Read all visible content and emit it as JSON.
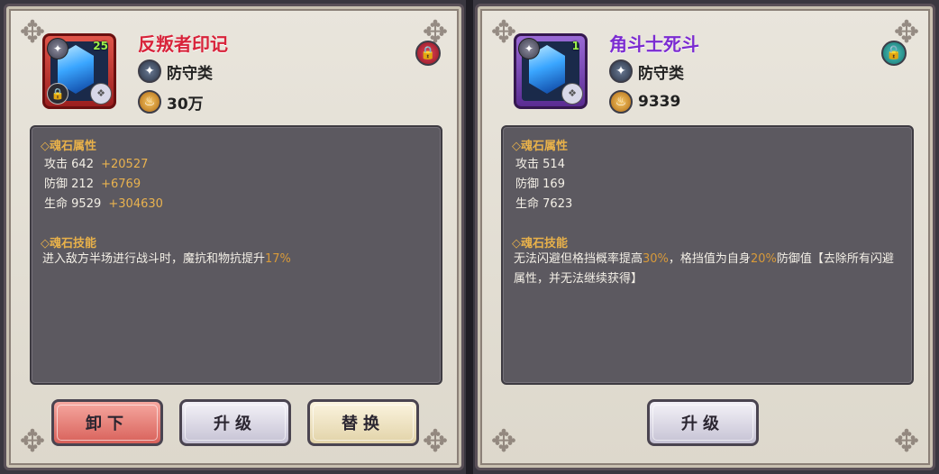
{
  "left": {
    "title": "反叛者印记",
    "level": "25",
    "type_text": "防守类",
    "power_text": "30万",
    "lock_state": "locked",
    "attr_title": "◇魂石属性",
    "stats": [
      {
        "label": "攻击",
        "value": "642",
        "bonus": "+20527"
      },
      {
        "label": "防御",
        "value": "212",
        "bonus": "+6769"
      },
      {
        "label": "生命",
        "value": "9529",
        "bonus": "+304630"
      }
    ],
    "skill_title": "◇魂石技能",
    "skill_pre": "进入敌方半场进行战斗时，魔抗和物抗提升",
    "skill_hl": "17%",
    "buttons": {
      "unequip": "卸下",
      "upgrade": "升级",
      "replace": "替换"
    }
  },
  "right": {
    "title": "角斗士死斗",
    "level": "1",
    "type_text": "防守类",
    "power_text": "9339",
    "lock_state": "unlocked",
    "attr_title": "◇魂石属性",
    "stats": [
      {
        "label": "攻击",
        "value": "514"
      },
      {
        "label": "防御",
        "value": "169"
      },
      {
        "label": "生命",
        "value": "7623"
      }
    ],
    "skill_title": "◇魂石技能",
    "skill_p1": "无法闪避但格挡概率提高",
    "skill_h1": "30%",
    "skill_p2": "，格挡值为自身",
    "skill_h2": "20%",
    "skill_p3": "防御值【去除所有闪避属性，并无法继续获得】",
    "buttons": {
      "upgrade": "升级"
    }
  },
  "colors": {
    "title_left": "#d8233a",
    "title_right": "#7b2bd1",
    "stat_bonus": "#e9b24f",
    "highlight": "#d89a3a"
  }
}
